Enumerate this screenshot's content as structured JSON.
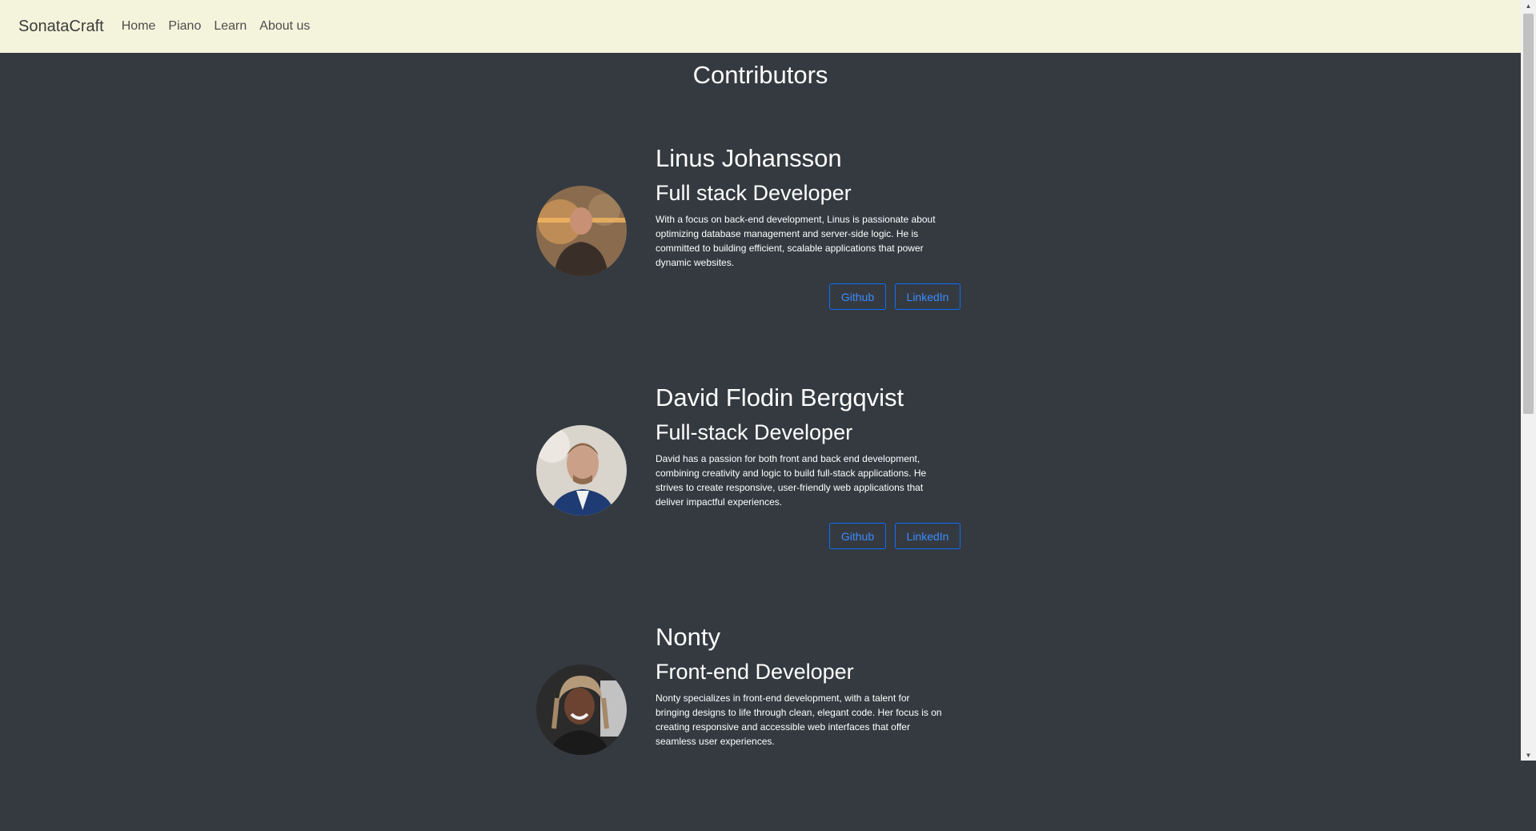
{
  "nav": {
    "brand": "SonataCraft",
    "links": [
      "Home",
      "Piano",
      "Learn",
      "About us"
    ]
  },
  "page_title": "Contributors",
  "contributors": [
    {
      "name": "Linus Johansson",
      "role": "Full stack Developer",
      "bio": "With a focus on back-end development, Linus is passionate about optimizing database management and server-side logic. He is committed to building efficient, scalable applications that power dynamic websites.",
      "github_label": "Github",
      "linkedin_label": "LinkedIn"
    },
    {
      "name": "David Flodin Bergqvist",
      "role": "Full-stack Developer",
      "bio": "David has a passion for both front and back end development, combining creativity and logic to build full-stack applications. He strives to create responsive, user-friendly web applications that deliver impactful experiences.",
      "github_label": "Github",
      "linkedin_label": "LinkedIn"
    },
    {
      "name": "Nonty",
      "role": "Front-end Developer",
      "bio": "Nonty specializes in front-end development, with a talent for bringing designs to life through clean, elegant code. Her focus is on creating responsive and accessible web interfaces that offer seamless user experiences."
    }
  ],
  "colors": {
    "navbar_bg": "#f4f4dc",
    "page_bg": "#343a40",
    "button_accent": "#0d6efd"
  },
  "icons": {
    "scroll_up": "scroll-up-arrow-icon",
    "scroll_down": "scroll-down-arrow-icon"
  }
}
